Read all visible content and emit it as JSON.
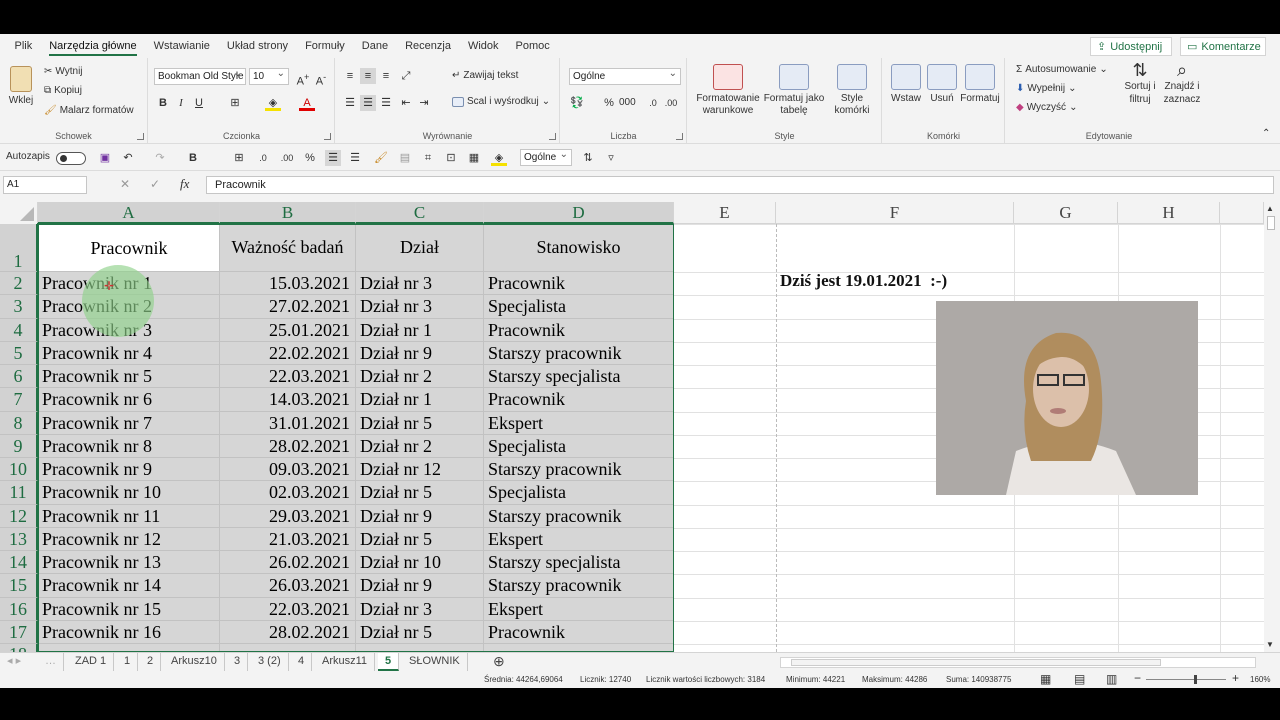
{
  "menu": {
    "tabs": [
      "Plik",
      "Narzędzia główne",
      "Wstawianie",
      "Układ strony",
      "Formuły",
      "Dane",
      "Recenzja",
      "Widok",
      "Pomoc"
    ],
    "active_tab": "Narzędzia główne",
    "share_label": "Udostępnij",
    "comments_label": "Komentarze"
  },
  "ribbon": {
    "clipboard": {
      "paste": "Wklej",
      "cut": "Wytnij",
      "copy": "Kopiuj",
      "painter": "Malarz formatów",
      "label": "Schowek"
    },
    "font": {
      "name": "Bookman Old Style",
      "size": "10",
      "label": "Czcionka"
    },
    "alignment": {
      "wrap": "Zawijaj tekst",
      "merge": "Scal i wyśrodkuj",
      "label": "Wyrównanie"
    },
    "number": {
      "format": "Ogólne",
      "label": "Liczba"
    },
    "styles": {
      "conditional": "Formatowanie warunkowe",
      "table": "Formatuj jako tabelę",
      "cell_styles": "Style komórki",
      "label": "Style"
    },
    "cells": {
      "insert": "Wstaw",
      "delete": "Usuń",
      "format": "Formatuj",
      "label": "Komórki"
    },
    "editing": {
      "autosum": "Autosumowanie",
      "fill": "Wypełnij",
      "clear": "Wyczyść",
      "sort": "Sortuj i filtruj",
      "find": "Znajdź i zaznacz",
      "label": "Edytowanie"
    }
  },
  "qat": {
    "autosave": "Autozapis",
    "format": "Ogólne"
  },
  "formula_bar": {
    "name_box": "A1",
    "formula": "Pracownik"
  },
  "columns": [
    "A",
    "B",
    "C",
    "D",
    "E",
    "F",
    "G",
    "H"
  ],
  "header_row": {
    "row": "1",
    "a": "Pracownik",
    "b": "Ważność badań",
    "c": "Dział",
    "d": "Stanowisko"
  },
  "rows": [
    {
      "n": "2",
      "a": "Pracownik nr 1",
      "b": "15.03.2021",
      "c": "Dział nr 3",
      "d": "Pracownik"
    },
    {
      "n": "3",
      "a": "Pracownik nr 2",
      "b": "27.02.2021",
      "c": "Dział nr 3",
      "d": "Specjalista"
    },
    {
      "n": "4",
      "a": "Pracownik nr 3",
      "b": "25.01.2021",
      "c": "Dział nr 1",
      "d": "Pracownik"
    },
    {
      "n": "5",
      "a": "Pracownik nr 4",
      "b": "22.02.2021",
      "c": "Dział nr 9",
      "d": "Starszy pracownik"
    },
    {
      "n": "6",
      "a": "Pracownik nr 5",
      "b": "22.03.2021",
      "c": "Dział nr 2",
      "d": "Starszy specjalista"
    },
    {
      "n": "7",
      "a": "Pracownik nr 6",
      "b": "14.03.2021",
      "c": "Dział nr 1",
      "d": "Pracownik"
    },
    {
      "n": "8",
      "a": "Pracownik nr 7",
      "b": "31.01.2021",
      "c": "Dział nr 5",
      "d": "Ekspert"
    },
    {
      "n": "9",
      "a": "Pracownik nr 8",
      "b": "28.02.2021",
      "c": "Dział nr 2",
      "d": "Specjalista"
    },
    {
      "n": "10",
      "a": "Pracownik nr 9",
      "b": "09.03.2021",
      "c": "Dział nr 12",
      "d": "Starszy pracownik"
    },
    {
      "n": "11",
      "a": "Pracownik nr 10",
      "b": "02.03.2021",
      "c": "Dział nr 5",
      "d": "Specjalista"
    },
    {
      "n": "12",
      "a": "Pracownik nr 11",
      "b": "29.03.2021",
      "c": "Dział nr 9",
      "d": "Starszy pracownik"
    },
    {
      "n": "13",
      "a": "Pracownik nr 12",
      "b": "21.03.2021",
      "c": "Dział nr 5",
      "d": "Ekspert"
    },
    {
      "n": "14",
      "a": "Pracownik nr 13",
      "b": "26.02.2021",
      "c": "Dział nr 10",
      "d": "Starszy specjalista"
    },
    {
      "n": "15",
      "a": "Pracownik nr 14",
      "b": "26.03.2021",
      "c": "Dział nr 9",
      "d": "Starszy pracownik"
    },
    {
      "n": "16",
      "a": "Pracownik nr 15",
      "b": "22.03.2021",
      "c": "Dział nr 3",
      "d": "Ekspert"
    },
    {
      "n": "17",
      "a": "Pracownik nr 16",
      "b": "28.02.2021",
      "c": "Dział nr 5",
      "d": "Pracownik"
    }
  ],
  "note_cell": "Dziś jest 19.01.2021  :-)",
  "sheet_tabs": [
    "ZAD 1",
    "1",
    "2",
    "Arkusz10",
    "3",
    "3 (2)",
    "4",
    "Arkusz11",
    "5",
    "SŁOWNIK"
  ],
  "active_sheet": "5",
  "status": {
    "average": "Średnia: 44264,69064",
    "count": "Licznik: 12740",
    "numcount": "Licznik wartości liczbowych: 3184",
    "min": "Minimum: 44221",
    "max": "Maksimum: 44286",
    "sum": "Suma: 140938775",
    "zoom": "160%"
  },
  "colors": {
    "accent": "#217346",
    "selection_fill": "#d6d6d6",
    "highlight": "#8fd18a"
  }
}
